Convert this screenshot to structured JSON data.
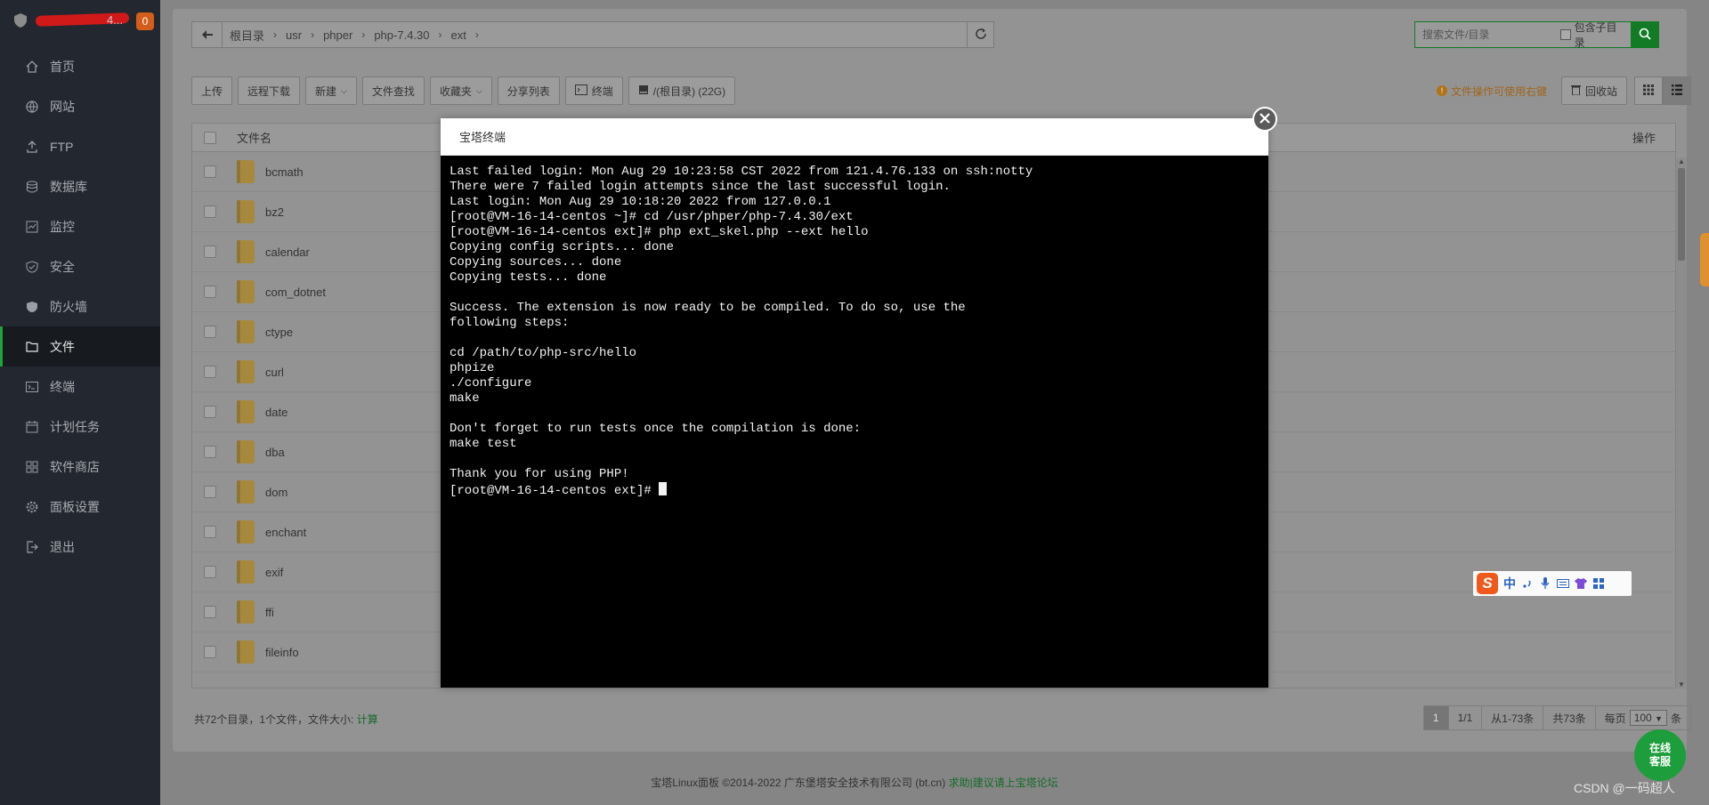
{
  "sidebar": {
    "brand_suffix": "4...",
    "notification_count": "0",
    "items": [
      {
        "label": "首页",
        "icon": "home-icon"
      },
      {
        "label": "网站",
        "icon": "globe-icon"
      },
      {
        "label": "FTP",
        "icon": "ftp-icon"
      },
      {
        "label": "数据库",
        "icon": "database-icon"
      },
      {
        "label": "监控",
        "icon": "monitor-icon"
      },
      {
        "label": "安全",
        "icon": "shield-check-icon"
      },
      {
        "label": "防火墙",
        "icon": "firewall-icon"
      },
      {
        "label": "文件",
        "icon": "folder-icon",
        "active": true
      },
      {
        "label": "终端",
        "icon": "terminal-icon"
      },
      {
        "label": "计划任务",
        "icon": "calendar-icon"
      },
      {
        "label": "软件商店",
        "icon": "apps-icon"
      },
      {
        "label": "面板设置",
        "icon": "gear-icon"
      },
      {
        "label": "退出",
        "icon": "logout-icon"
      }
    ]
  },
  "path": {
    "crumbs": [
      "根目录",
      "usr",
      "phper",
      "php-7.4.30",
      "ext"
    ]
  },
  "search": {
    "placeholder": "搜索文件/目录",
    "include_subdir_label": "包含子目录"
  },
  "toolbar": {
    "upload": "上传",
    "remote_download": "远程下载",
    "new": "新建",
    "file_search": "文件查找",
    "favorites": "收藏夹",
    "share_list": "分享列表",
    "terminal": "终端",
    "disk": "/(根目录) (22G)"
  },
  "right_tools": {
    "hint": "文件操作可使用右键",
    "recycle_bin": "回收站"
  },
  "table": {
    "col_name": "文件名",
    "col_op": "操作",
    "rows": [
      "bcmath",
      "bz2",
      "calendar",
      "com_dotnet",
      "ctype",
      "curl",
      "date",
      "dba",
      "dom",
      "enchant",
      "exif",
      "ffi",
      "fileinfo"
    ]
  },
  "footer": {
    "stats": "共72个目录，1个文件，文件大小:",
    "calc": "计算"
  },
  "pager": {
    "current": "1",
    "pages": "1/1",
    "range": "从1-73条",
    "total": "共73条",
    "per_page_label": "每页",
    "per_page": "100",
    "unit": "条"
  },
  "copyright": {
    "text": "宝塔Linux面板 ©2014-2022 广东堡塔安全技术有限公司 (bt.cn)",
    "forum": "求助|建议请上宝塔论坛"
  },
  "modal": {
    "title": "宝塔终端",
    "terminal_lines": [
      "Last failed login: Mon Aug 29 10:23:58 CST 2022 from 121.4.76.133 on ssh:notty",
      "There were 7 failed login attempts since the last successful login.",
      "Last login: Mon Aug 29 10:18:20 2022 from 127.0.0.1",
      "[root@VM-16-14-centos ~]# cd /usr/phper/php-7.4.30/ext",
      "[root@VM-16-14-centos ext]# php ext_skel.php --ext hello",
      "Copying config scripts... done",
      "Copying sources... done",
      "Copying tests... done",
      "",
      "Success. The extension is now ready to be compiled. To do so, use the",
      "following steps:",
      "",
      "cd /path/to/php-src/hello",
      "phpize",
      "./configure",
      "make",
      "",
      "Don't forget to run tests once the compilation is done:",
      "make test",
      "",
      "Thank you for using PHP!"
    ],
    "prompt": "[root@VM-16-14-centos ext]# "
  },
  "ime": {
    "lang": "中"
  },
  "chat": {
    "line1": "在线",
    "line2": "客服"
  },
  "watermark": "CSDN @一码超人"
}
